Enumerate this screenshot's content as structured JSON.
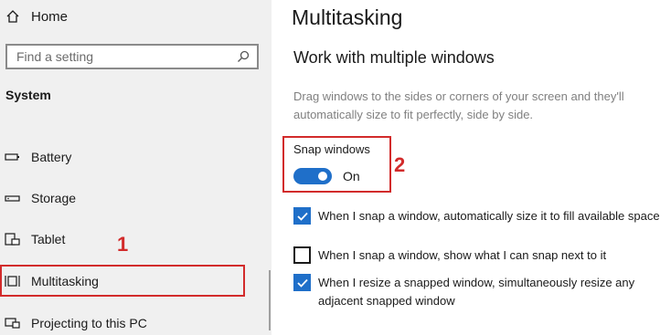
{
  "sidebar": {
    "home_label": "Home",
    "search_placeholder": "Find a setting",
    "section_title": "System",
    "items": [
      {
        "label": "Battery",
        "icon": "battery-icon"
      },
      {
        "label": "Storage",
        "icon": "storage-icon"
      },
      {
        "label": "Tablet",
        "icon": "tablet-icon"
      },
      {
        "label": "Multitasking",
        "icon": "multitasking-icon",
        "selected": true
      },
      {
        "label": "Projecting to this PC",
        "icon": "projecting-icon"
      }
    ]
  },
  "annotations": {
    "mark1": "1",
    "mark2": "2",
    "color": "#d22b2b"
  },
  "main": {
    "title": "Multitasking",
    "section_title": "Work with multiple windows",
    "description": "Drag windows to the sides or corners of your screen and they'll automatically size to fit perfectly, side by side.",
    "snap": {
      "label": "Snap windows",
      "state": "On",
      "enabled": true
    },
    "options": [
      {
        "label": "When I snap a window, automatically size it to fill available space",
        "checked": true
      },
      {
        "label": "When I snap a window, show what I can snap next to it",
        "checked": false
      },
      {
        "label": "When I resize a snapped window, simultaneously resize any adjacent snapped window",
        "checked": true
      }
    ]
  },
  "colors": {
    "accent": "#1f6fc9",
    "sidebar_bg": "#f0f0f0"
  }
}
